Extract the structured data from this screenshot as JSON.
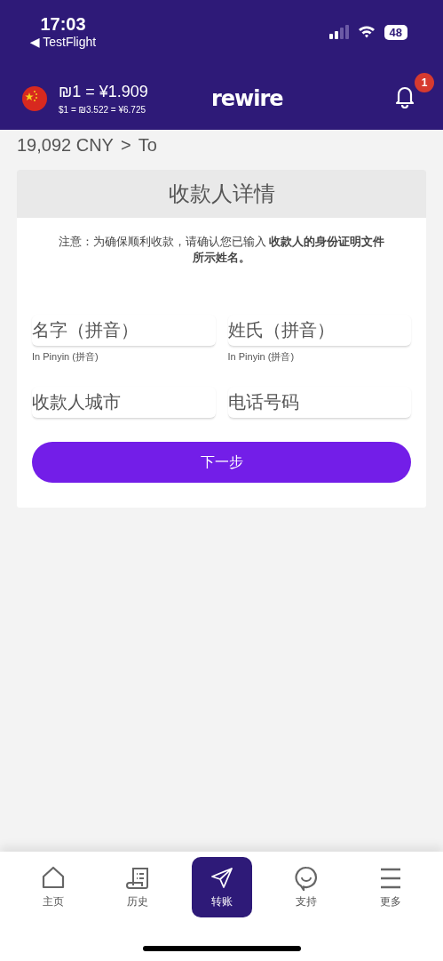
{
  "status_bar": {
    "time": "17:03",
    "back_app": "◀ TestFlight",
    "battery": "48"
  },
  "header": {
    "rate_main": "₪1 = ¥1.909",
    "rate_sub": "$1 = ₪3.522 = ¥6.725",
    "logo": "rewire",
    "notification_count": "1"
  },
  "breadcrumb": {
    "amount": "19,092 CNY",
    "separator": ">",
    "step": "To"
  },
  "form": {
    "title": "收款人详情",
    "note": "注意：为确保顺利收款，请确认您已输入 **收款人的身份证明文件所示姓名。**",
    "fields": [
      {
        "placeholder": "名字（拼音）",
        "helper": "In Pinyin (拼音)"
      },
      {
        "placeholder": "姓氏（拼音）",
        "helper": "In Pinyin (拼音)"
      },
      {
        "placeholder": "收款人城市"
      },
      {
        "placeholder": "电话号码"
      }
    ],
    "submit": "下一步"
  },
  "tab_bar": [
    {
      "kind": "home",
      "label": "主页",
      "selected": false
    },
    {
      "kind": "history",
      "label": "历史",
      "selected": false
    },
    {
      "kind": "transfer",
      "label": "转账",
      "selected": true
    },
    {
      "kind": "support",
      "label": "支持",
      "selected": false
    },
    {
      "kind": "more",
      "label": "更多",
      "selected": false
    }
  ]
}
